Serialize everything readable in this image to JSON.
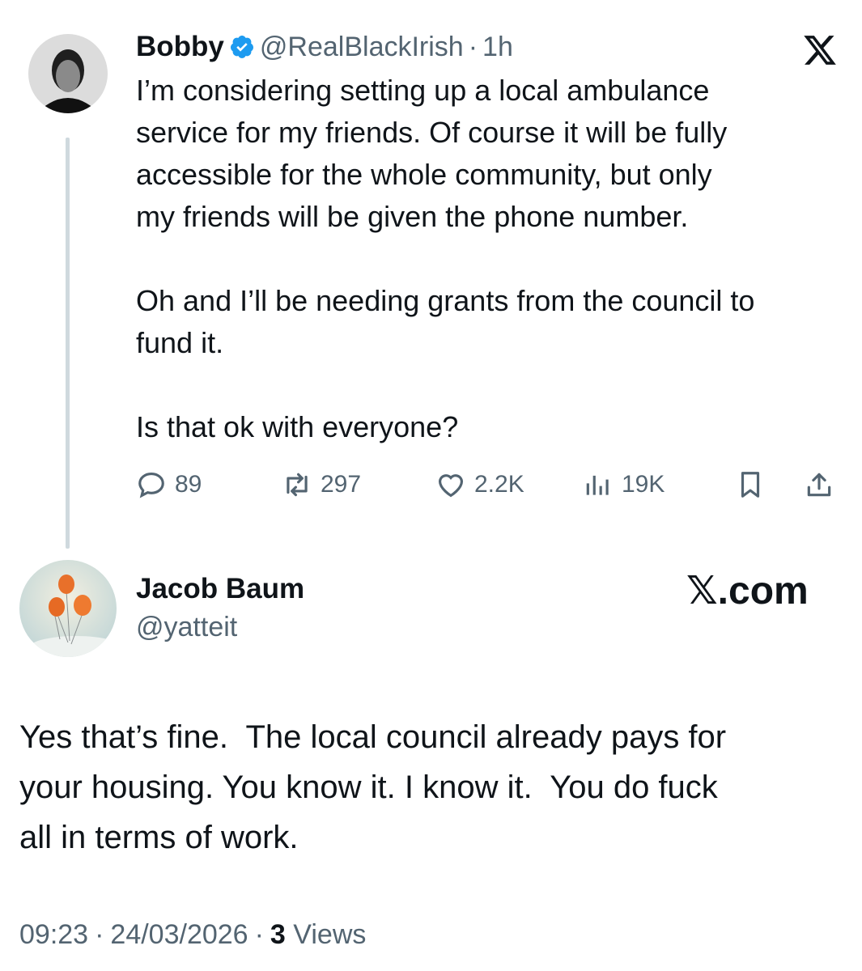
{
  "tweet": {
    "author_name": "Bobby",
    "verified_badge_icon": "verified-badge-icon",
    "handle": "@RealBlackIrish",
    "separator": "·",
    "time": "1h",
    "text": "I’m considering setting up a local ambulance\nservice for my friends. Of course it will be fully\naccessible for the whole community, but only\nmy friends will be given the phone number.\n\nOh and I’ll be needing grants from the council to\nfund it.\n\nIs that ok with everyone?",
    "actions": {
      "replies": "89",
      "reposts": "297",
      "likes": "2.2K",
      "views": "19K"
    }
  },
  "reply": {
    "author_name": "Jacob Baum",
    "handle": "@yatteit",
    "brand": "𝕏.com",
    "text": "Yes that’s fine.  The local council already pays for\nyour housing. You know it. I know it.  You do fuck\nall in terms of work.",
    "footer": {
      "time": "09:23",
      "sep1": "·",
      "date": "24/03/2026",
      "sep2": "·",
      "views_count": "3",
      "views_label": "Views"
    }
  },
  "colors": {
    "verified": "#1d9bf0",
    "muted": "#536471",
    "thread_line": "#cfd9de"
  }
}
